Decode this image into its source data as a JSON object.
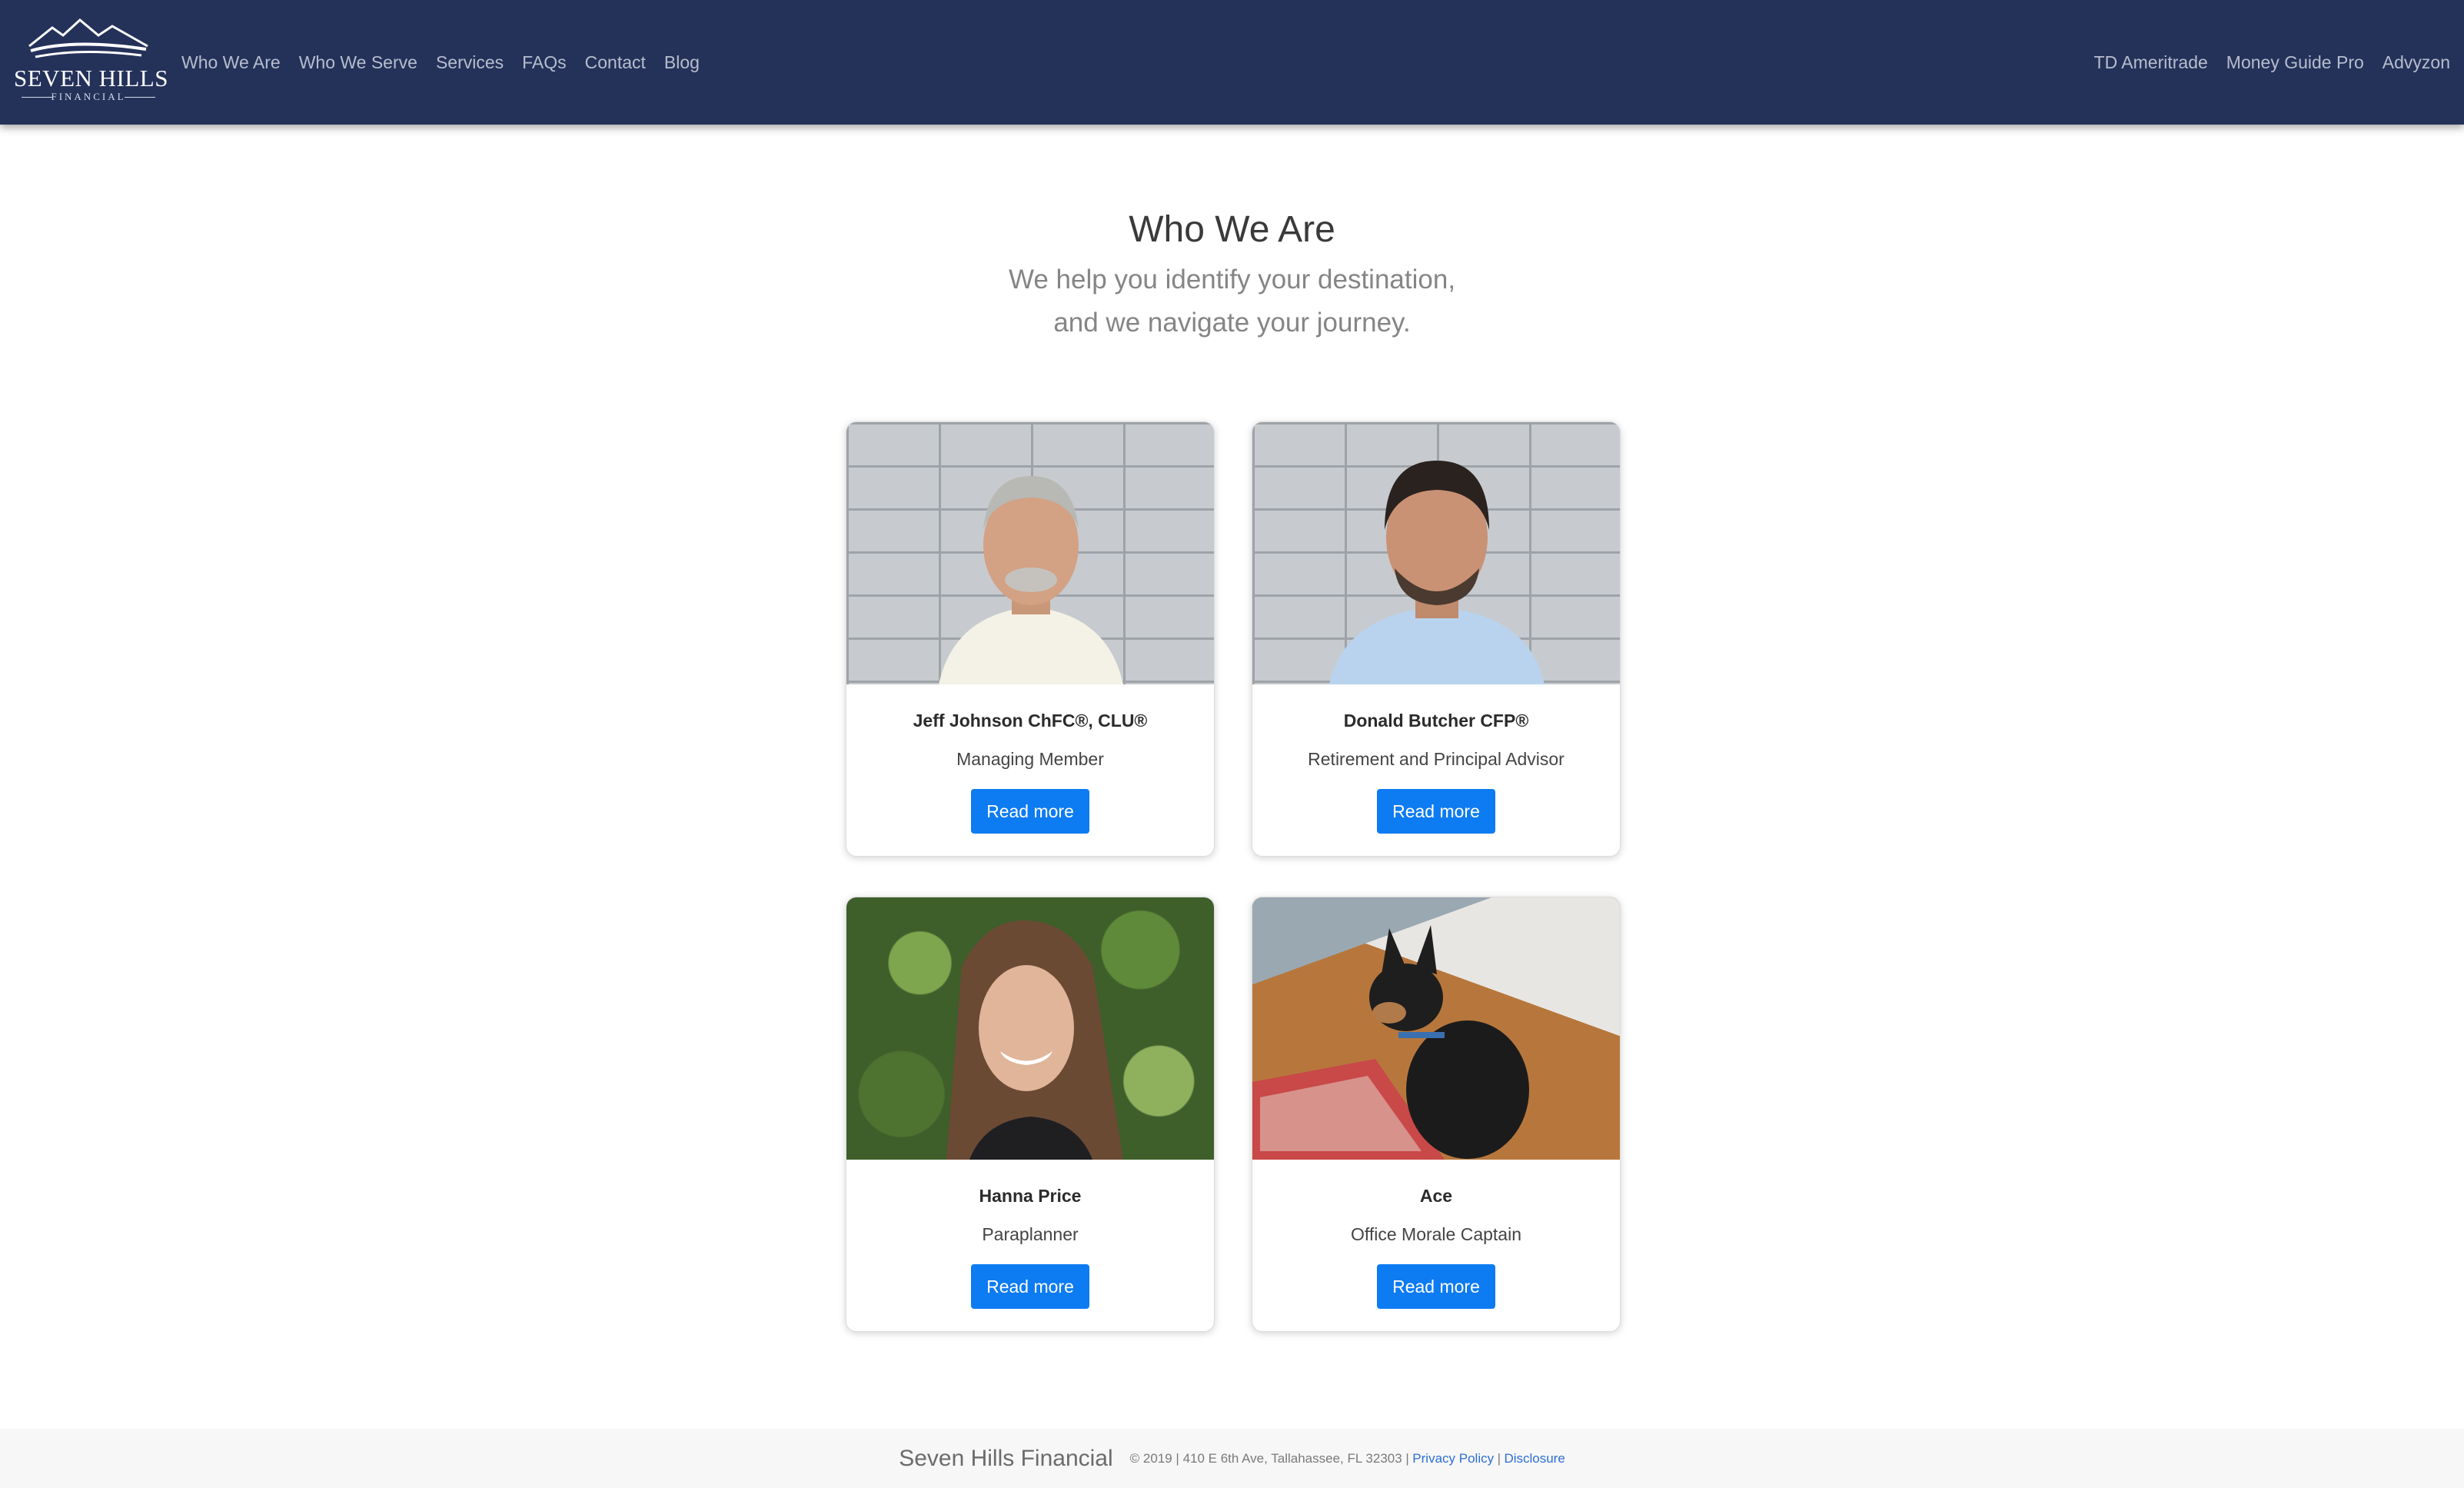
{
  "brand": {
    "name": "SEVEN HILLS",
    "sub": "FINANCIAL",
    "logo_icon": "mountains-logo-icon"
  },
  "nav": {
    "left": [
      "Who We Are",
      "Who We Serve",
      "Services",
      "FAQs",
      "Contact",
      "Blog"
    ],
    "right": [
      "TD Ameritrade",
      "Money Guide Pro",
      "Advyzon"
    ]
  },
  "hero": {
    "title": "Who We Are",
    "subtitle_line1": "We help you identify your destination,",
    "subtitle_line2": "and we navigate your journey."
  },
  "cards": [
    {
      "name": "Jeff Johnson ChFC®, CLU®",
      "role": "Managing Member",
      "button": "Read more",
      "photo": "portrait-photo-man-gray-hair"
    },
    {
      "name": "Donald Butcher CFP®",
      "role": "Retirement and Principal Advisor",
      "button": "Read more",
      "photo": "portrait-photo-man-dark-hair"
    },
    {
      "name": "Hanna Price",
      "role": "Paraplanner",
      "button": "Read more",
      "photo": "portrait-photo-woman"
    },
    {
      "name": "Ace",
      "role": "Office Morale Captain",
      "button": "Read more",
      "photo": "dog-photo"
    }
  ],
  "footer": {
    "brand": "Seven Hills Financial",
    "info": "© 2019 | 410 E 6th Ave, Tallahassee, FL 32303 |",
    "privacy": "Privacy Policy",
    "separator": "|",
    "disclosure": "Disclosure"
  },
  "colors": {
    "navbar": "#24325a",
    "button": "#0d7bf2",
    "link": "#2d6fd6"
  }
}
